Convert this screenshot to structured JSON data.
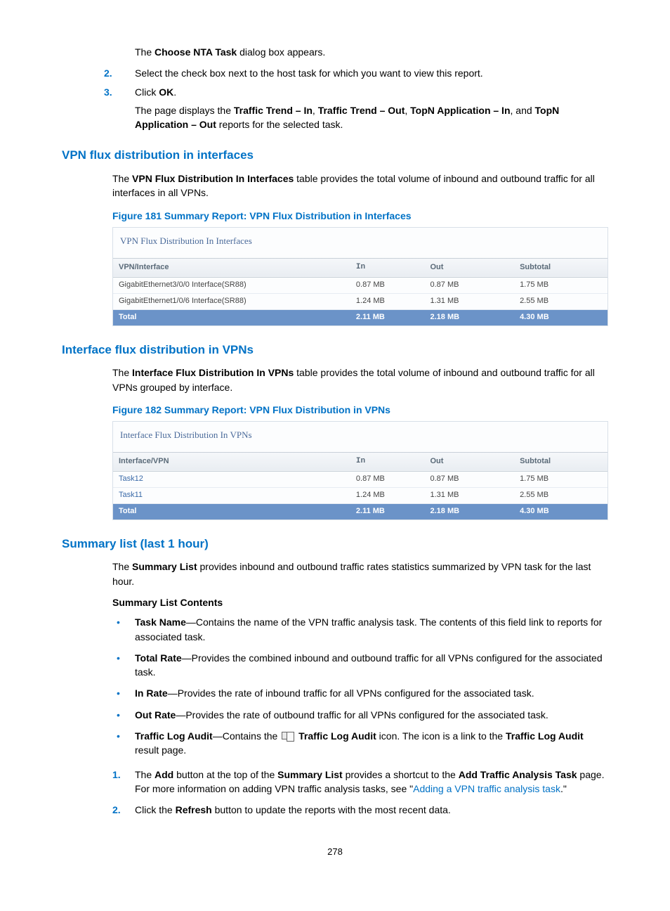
{
  "intro": {
    "step1_pre": "The ",
    "step1_bold": "Choose NTA Task",
    "step1_post": " dialog box appears.",
    "step2": "Select the check box next to the host task for which you want to view this report.",
    "step3_a": "Click ",
    "step3_b": "OK",
    "step3_c": ".",
    "after_pre": "The page displays the ",
    "t1": "Traffic Trend – In",
    "t2": "Traffic Trend – Out",
    "t3": "TopN Application – In",
    "t4": "TopN Application – Out",
    "after_post": " reports for the selected task."
  },
  "sec1": {
    "heading": "VPN flux distribution in interfaces",
    "para_a": "The ",
    "para_b": "VPN Flux Distribution In Interfaces",
    "para_c": " table provides the total volume of inbound and outbound traffic for all interfaces in all VPNs.",
    "fig_caption": "Figure 181 Summary Report: VPN Flux Distribution in Interfaces",
    "fig_title": "VPN Flux Distribution In Interfaces",
    "headers": {
      "c1": "VPN/Interface",
      "c2": "In",
      "c3": "Out",
      "c4": "Subtotal"
    },
    "rows": [
      {
        "name": "GigabitEthernet3/0/0 Interface(SR88)",
        "in": "0.87 MB",
        "out": "0.87 MB",
        "sub": "1.75 MB"
      },
      {
        "name": "GigabitEthernet1/0/6 Interface(SR88)",
        "in": "1.24 MB",
        "out": "1.31 MB",
        "sub": "2.55 MB"
      }
    ],
    "total": {
      "name": "Total",
      "in": "2.11 MB",
      "out": "2.18 MB",
      "sub": "4.30 MB"
    }
  },
  "sec2": {
    "heading": "Interface flux distribution in VPNs",
    "para_a": "The ",
    "para_b": "Interface Flux Distribution In VPNs",
    "para_c": " table provides the total volume of inbound and outbound traffic for all VPNs grouped by interface.",
    "fig_caption": "Figure 182 Summary Report: VPN Flux Distribution in VPNs",
    "fig_title": "Interface Flux Distribution In VPNs",
    "headers": {
      "c1": "Interface/VPN",
      "c2": "In",
      "c3": "Out",
      "c4": "Subtotal"
    },
    "rows": [
      {
        "name": "Task12",
        "in": "0.87 MB",
        "out": "0.87 MB",
        "sub": "1.75 MB",
        "link": true
      },
      {
        "name": "Task11",
        "in": "1.24 MB",
        "out": "1.31 MB",
        "sub": "2.55 MB",
        "link": true
      }
    ],
    "total": {
      "name": "Total",
      "in": "2.11 MB",
      "out": "2.18 MB",
      "sub": "4.30 MB"
    }
  },
  "sec3": {
    "heading": "Summary list (last 1 hour)",
    "para_a": "The ",
    "para_b": "Summary List",
    "para_c": " provides inbound and outbound traffic rates statistics summarized by VPN task for the last hour.",
    "contents_heading": "Summary List Contents",
    "items": {
      "b1_t": "Task Name",
      "b1_d": "—Contains the name of the VPN traffic analysis task. The contents of this field link to reports for associated task.",
      "b2_t": "Total Rate",
      "b2_d": "—Provides the combined inbound and outbound traffic for all VPNs configured for the associated task.",
      "b3_t": "In Rate",
      "b3_d": "—Provides the rate of inbound traffic for all VPNs configured for the associated task.",
      "b4_t": "Out Rate",
      "b4_d": "—Provides the rate of outbound traffic for all VPNs configured for the associated task.",
      "b5_t": "Traffic Log Audit",
      "b5_d1": "—Contains the ",
      "b5_bold2": "Traffic Log Audit",
      "b5_d2": " icon. The icon is a link to the ",
      "b5_bold3": "Traffic Log Audit",
      "b5_d3": " result page."
    },
    "n1_a": "The ",
    "n1_b": "Add",
    "n1_c": " button at the top of the ",
    "n1_d": "Summary List",
    "n1_e": " provides a shortcut to the ",
    "n1_f": "Add Traffic Analysis Task",
    "n1_g": " page. For more information on adding VPN traffic analysis tasks, see \"",
    "n1_link": "Adding a VPN traffic analysis task",
    "n1_h": ".\"",
    "n2_a": "Click the ",
    "n2_b": "Refresh",
    "n2_c": " button to update the reports with the most recent data."
  },
  "page": "278",
  "nums": {
    "n1": "1.",
    "n2": "2.",
    "n3": "3."
  },
  "sep": {
    "comma_sp": ", ",
    "and": ", and "
  }
}
